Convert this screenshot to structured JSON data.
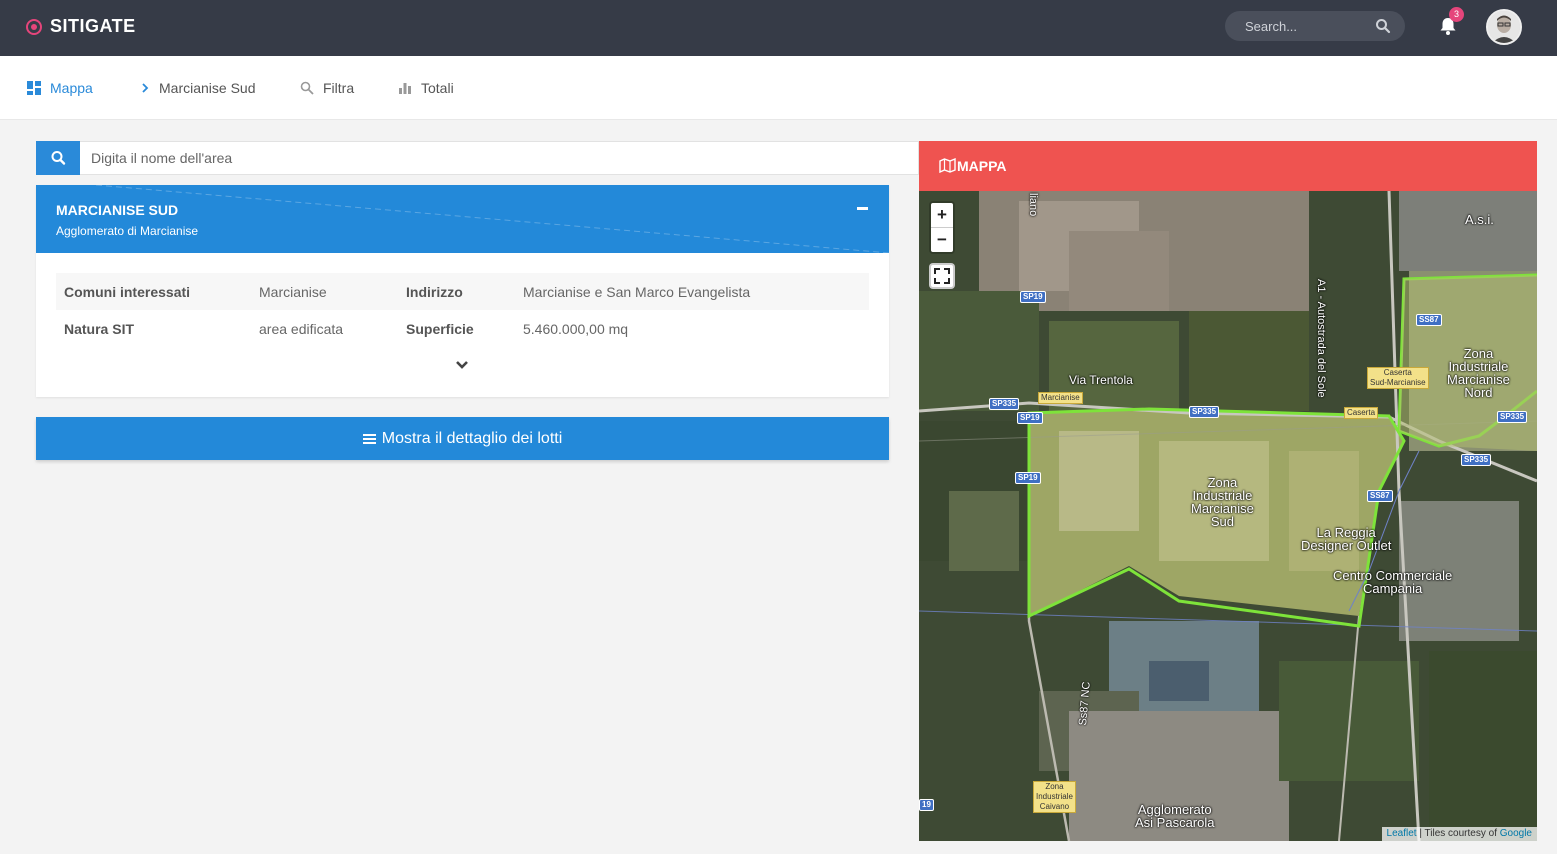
{
  "app": {
    "name": "SITIGATE",
    "search_placeholder": "Search...",
    "notifications_count": "3",
    "brand_color": "#e5457b"
  },
  "nav": {
    "items": [
      {
        "label": "Mappa",
        "icon": "dashboard-icon",
        "active": true
      },
      {
        "label": "Marcianise Sud",
        "icon": "chevron-right-icon",
        "active": false
      },
      {
        "label": "Filtra",
        "icon": "search-icon",
        "active": false
      },
      {
        "label": "Totali",
        "icon": "bar-chart-icon",
        "active": false
      }
    ]
  },
  "area_search": {
    "placeholder": "Digita il nome dell'area"
  },
  "area_card": {
    "title": "MARCIANISE SUD",
    "subtitle": "Agglomerato di Marcianise",
    "rows": [
      {
        "label1": "Comuni interessati",
        "value1": "Marcianise",
        "label2": "Indirizzo",
        "value2": "Marcianise e San Marco Evangelista"
      },
      {
        "label1": "Natura SIT",
        "value1": "area edificata",
        "label2": "Superficie",
        "value2": "5.460.000,00 mq"
      }
    ]
  },
  "detail_button": {
    "label": "Mostra il dettaglio dei lotti"
  },
  "map": {
    "header": "MAPPA",
    "zoom_in": "+",
    "zoom_out": "−",
    "attribution_leaflet": "Leaflet",
    "attribution_sep": " | Tiles courtesy of ",
    "attribution_google": "Google",
    "labels": {
      "via_trentola": "Via Trentola",
      "zona_sud_1": "Zona",
      "zona_sud_2": "Industriale",
      "zona_sud_3": "Marcianise",
      "zona_sud_4": "Sud",
      "zona_nord_1": "Zona",
      "zona_nord_2": "Industriale",
      "zona_nord_3": "Marcianise",
      "zona_nord_4": "Nord",
      "reggia_1": "La Reggia",
      "reggia_2": "Designer Outlet",
      "centro_1": "Centro Commerciale",
      "centro_2": "Campania",
      "asi": "A.s.i.",
      "autostrada": "A1 - Autostrada del Sole",
      "ss87nc": "Ss87 NC",
      "pascarola_1": "Agglomerato",
      "pascarola_2": "Asi Pascarola",
      "liano": "liano"
    },
    "shields": {
      "sp19_a": "SP19",
      "sp19_b": "SP19",
      "sp19_c": "SP19",
      "sp335_a": "SP335",
      "sp335_b": "SP335",
      "sp335_c": "SP335",
      "sp335_d": "SP335",
      "ss87_a": "SS87",
      "ss87_b": "SS87",
      "n19": "19"
    },
    "tags": {
      "marcianise": "Marcianise",
      "caserta_sud_1": "Caserta",
      "caserta_sud_2": "Sud-Marcianise",
      "caserta": "Caserta",
      "caivano_1": "Zona",
      "caivano_2": "Industriale",
      "caivano_3": "Caivano"
    }
  }
}
